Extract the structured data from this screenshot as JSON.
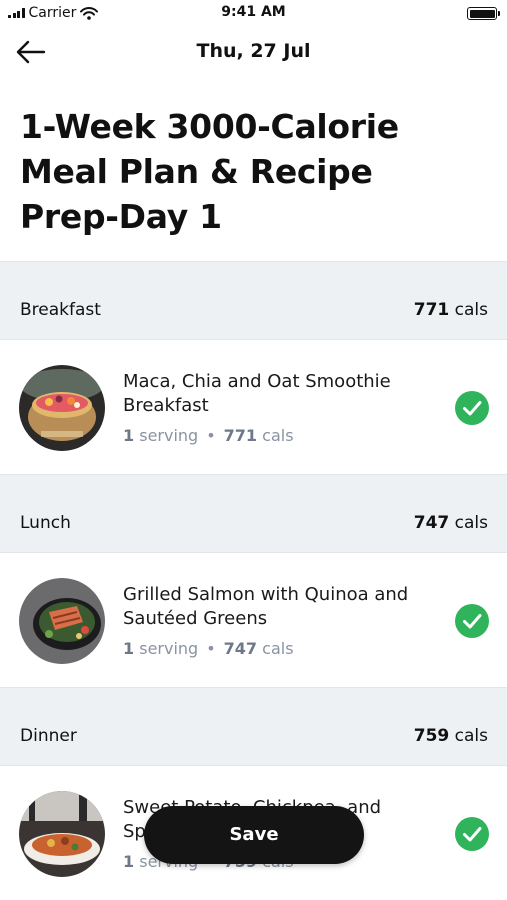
{
  "status_bar": {
    "carrier": "Carrier",
    "time": "9:41 AM"
  },
  "nav": {
    "date": "Thu, 27 Jul"
  },
  "title": "1-Week 3000-Calorie Meal Plan & Recipe Prep-Day 1",
  "sections": [
    {
      "name": "Breakfast",
      "cals_value": "771",
      "cals_unit": "cals",
      "meal": {
        "name": "Maca, Chia and Oat Smoothie Breakfast",
        "servings": "1",
        "serving_unit": "serving",
        "cals_value": "771",
        "cals_unit": "cals"
      }
    },
    {
      "name": "Lunch",
      "cals_value": "747",
      "cals_unit": "cals",
      "meal": {
        "name": "Grilled Salmon with Quinoa and Sautéed Greens",
        "servings": "1",
        "serving_unit": "serving",
        "cals_value": "747",
        "cals_unit": "cals"
      }
    },
    {
      "name": "Dinner",
      "cals_value": "759",
      "cals_unit": "cals",
      "meal": {
        "name": "Sweet Potato, Chickpea, and Spinach Curry",
        "servings": "1",
        "serving_unit": "serving",
        "cals_value": "759",
        "cals_unit": "cals"
      }
    }
  ],
  "save_label": "Save",
  "colors": {
    "check": "#2fb45c",
    "section_bg": "#eef1f4",
    "meta": "#8a93a3",
    "save_bg": "#141414"
  }
}
